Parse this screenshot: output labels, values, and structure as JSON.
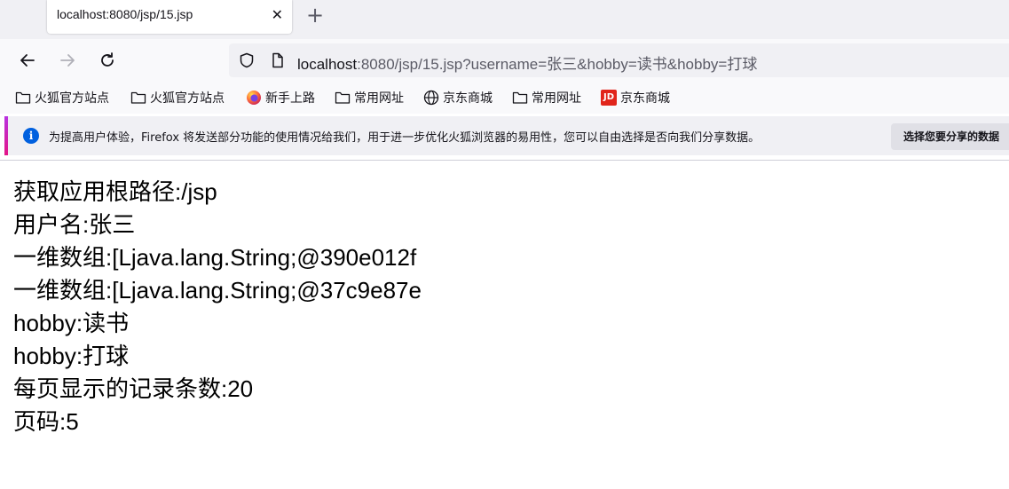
{
  "tab": {
    "title": "localhost:8080/jsp/15.jsp",
    "close": "✕",
    "new_tab": "+"
  },
  "url": {
    "host": "localhost",
    "rest": ":8080/jsp/15.jsp?username=张三&hobby=读书&hobby=打球"
  },
  "bookmarks": [
    {
      "label": "火狐官方站点",
      "icon": "folder-icon"
    },
    {
      "label": "火狐官方站点",
      "icon": "folder-icon"
    },
    {
      "label": "新手上路",
      "icon": "firefox-icon"
    },
    {
      "label": "常用网址",
      "icon": "folder-icon"
    },
    {
      "label": "京东商城",
      "icon": "globe-icon"
    },
    {
      "label": "常用网址",
      "icon": "folder-icon"
    },
    {
      "label": "京东商城",
      "icon": "jd-logo-icon"
    }
  ],
  "jd_logo_text": "JD",
  "notice": {
    "info": "i",
    "text": "为提高用户体验，Firefox 将发送部分功能的使用情况给我们，用于进一步优化火狐浏览器的易用性，您可以自由选择是否向我们分享数据。",
    "button": "选择您要分享的数据"
  },
  "content": {
    "lines": [
      "获取应用根路径:/jsp",
      "用户名:张三",
      "一维数组:[Ljava.lang.String;@390e012f",
      "一维数组:[Ljava.lang.String;@37c9e87e",
      "hobby:读书",
      "hobby:打球",
      "每页显示的记录条数:20",
      "页码:5"
    ]
  },
  "colors": {
    "accent": "#0060df",
    "jd_red": "#e1251b",
    "text": "#15141a"
  }
}
